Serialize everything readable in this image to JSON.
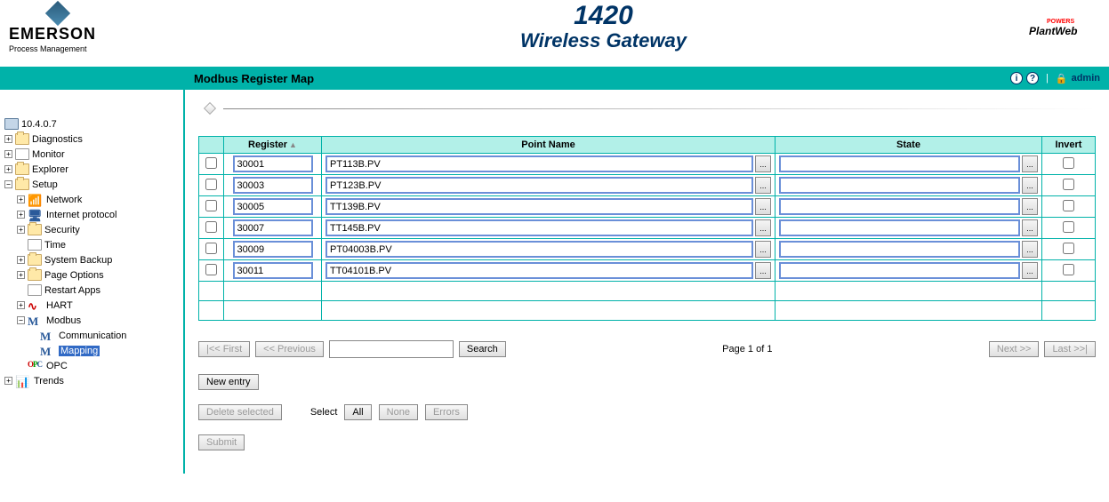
{
  "header": {
    "brand": "EMERSON",
    "brand_sub": "Process Management",
    "title_num": "1420",
    "title_text": "Wireless Gateway",
    "right_logo": "PlantWeb",
    "right_logo_tag": "POWERS"
  },
  "titlebar": {
    "title": "Modbus Register Map",
    "user": "admin"
  },
  "tree": {
    "root": "10.4.0.7",
    "diagnostics": "Diagnostics",
    "monitor": "Monitor",
    "explorer": "Explorer",
    "setup": "Setup",
    "network": "Network",
    "internet": "Internet protocol",
    "security": "Security",
    "time": "Time",
    "system_backup": "System Backup",
    "page_options": "Page Options",
    "restart_apps": "Restart Apps",
    "hart": "HART",
    "modbus": "Modbus",
    "communication": "Communication",
    "mapping": "Mapping",
    "opc": "OPC",
    "trends": "Trends"
  },
  "table": {
    "headers": {
      "register": "Register",
      "point_name": "Point Name",
      "state": "State",
      "invert": "Invert"
    },
    "rows": [
      {
        "register": "30001",
        "point_name": "PT113B.PV",
        "state": ""
      },
      {
        "register": "30003",
        "point_name": "PT123B.PV",
        "state": ""
      },
      {
        "register": "30005",
        "point_name": "TT139B.PV",
        "state": ""
      },
      {
        "register": "30007",
        "point_name": "TT145B.PV",
        "state": ""
      },
      {
        "register": "30009",
        "point_name": "PT04003B.PV",
        "state": ""
      },
      {
        "register": "30011",
        "point_name": "TT04101B.PV",
        "state": ""
      }
    ]
  },
  "pager": {
    "first": "|<< First",
    "prev": "<< Previous",
    "search": "Search",
    "page_info": "Page 1 of 1",
    "next": "Next >>",
    "last": "Last >>|"
  },
  "actions": {
    "new_entry": "New entry",
    "delete_selected": "Delete selected",
    "select_label": "Select",
    "all": "All",
    "none": "None",
    "errors": "Errors",
    "submit": "Submit"
  },
  "browse_btn": "..."
}
